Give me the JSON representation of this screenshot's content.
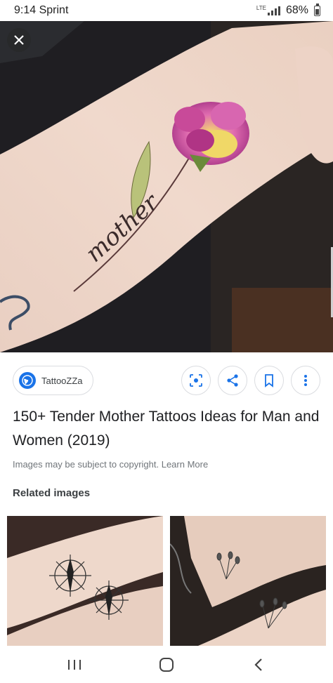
{
  "status_bar": {
    "time_carrier": "9:14 Sprint",
    "network": "LTE",
    "battery": "68%"
  },
  "hero": {
    "tattoo_word": "mother"
  },
  "source": {
    "name": "TattooZZa"
  },
  "result": {
    "title": "150+ Tender Mother Tattoos Ideas for Man and Women (2019)",
    "copyright_text": "Images may be subject to copyright. Learn More"
  },
  "related": {
    "heading": "Related images"
  },
  "colors": {
    "accent": "#1a73e8",
    "chip_border": "#dadce0"
  },
  "icons": {
    "close": "close-icon",
    "lens": "lens-icon",
    "share": "share-icon",
    "bookmark": "bookmark-icon",
    "more": "more-vert-icon",
    "nav_recents": "recents-icon",
    "nav_home": "home-icon",
    "nav_back": "back-icon"
  }
}
